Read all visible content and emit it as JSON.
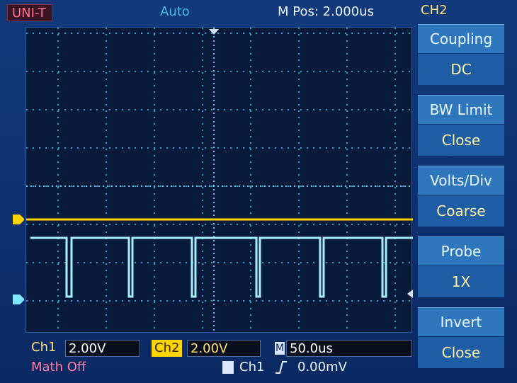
{
  "topbar": {
    "brand": "UNI-T",
    "mode": "Auto",
    "mpos": "M Pos: 2.000us",
    "channel": "CH2"
  },
  "menu": [
    {
      "label": "Coupling",
      "value": "DC"
    },
    {
      "label": "BW Limit",
      "value": "Close"
    },
    {
      "label": "Volts/Div",
      "value": "Coarse"
    },
    {
      "label": "Probe",
      "value": "1X"
    },
    {
      "label": "Invert",
      "value": "Close"
    }
  ],
  "status": {
    "ch1_label": "Ch1",
    "ch1_scale": "2.00V",
    "ch2_label": "Ch2",
    "ch2_scale": "2.00V",
    "time_label": "M",
    "timebase": "50.0us",
    "math": "Math Off",
    "trigger_source": "Ch1",
    "trigger_level": "0.00mV"
  },
  "markers": {
    "ch1": "1",
    "ch2": "2"
  },
  "colors": {
    "ch1": "#ffd400",
    "ch2": "#7fe7ff",
    "grid": "#21a0c8",
    "menu": "#2f77bd"
  }
}
